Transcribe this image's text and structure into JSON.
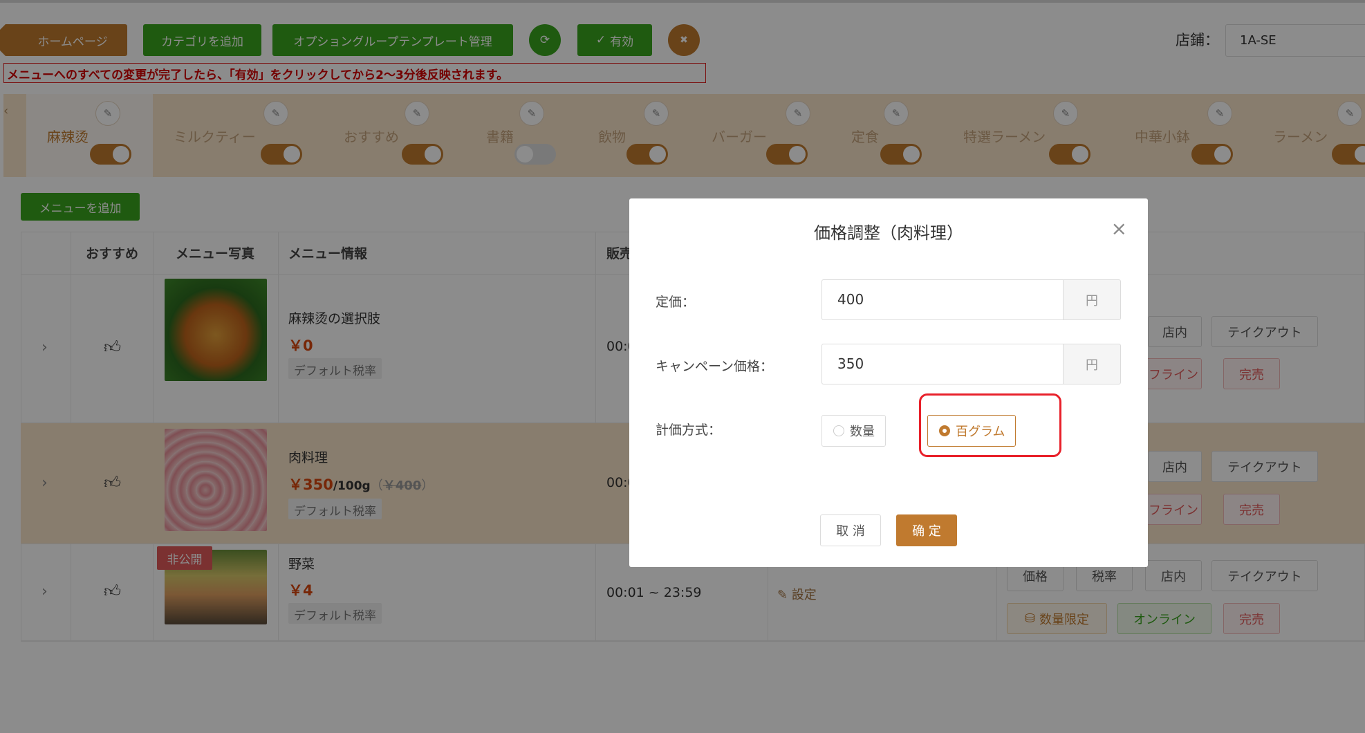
{
  "toolbar": {
    "home_label": "ホームページ",
    "add_category_label": "カテゴリを追加",
    "template_label": "オプショングループテンプレート管理",
    "valid_label": "有効",
    "store_label": "店鋪：",
    "store_value": "1A-SE"
  },
  "notice": "メニューへのすべての変更が完了したら、「有効」をクリックしてから2〜3分後反映されます。",
  "categories": [
    {
      "name": "麻辣烫",
      "enabled": true
    },
    {
      "name": "ミルクティー",
      "enabled": true
    },
    {
      "name": "おすすめ",
      "enabled": true
    },
    {
      "name": "書籍",
      "enabled": false
    },
    {
      "name": "飲物",
      "enabled": true
    },
    {
      "name": "バーガー",
      "enabled": true
    },
    {
      "name": "定食",
      "enabled": true
    },
    {
      "name": "特選ラーメン",
      "enabled": true
    },
    {
      "name": "中華小鉢",
      "enabled": true
    },
    {
      "name": "ラーメン",
      "enabled": true
    }
  ],
  "add_menu_label": "メニューを追加",
  "table": {
    "headers": [
      "おすすめ",
      "メニュー写真",
      "メニュー情報",
      "販売"
    ],
    "rows": [
      {
        "name": "麻辣烫の選択肢",
        "price": "￥0",
        "tax": "デフォルト税率",
        "time": "00:0",
        "tags": [
          "店内",
          "テイクアウト",
          "フライン",
          "完売"
        ]
      },
      {
        "name": "肉料理",
        "price": "￥350",
        "unit": "/100g",
        "orig_open": "（",
        "orig_price": "￥400",
        "orig_close": "）",
        "tax": "デフォルト税率",
        "time": "00:0",
        "tags": [
          "店内",
          "テイクアウト",
          "フライン",
          "完売"
        ]
      },
      {
        "name": "野菜",
        "price": "￥4",
        "tax": "デフォルト税率",
        "time": "00:01 ~ 23:59",
        "setting": "設定",
        "private": "非公開",
        "tags": [
          "価格",
          "税率",
          "店内",
          "テイクアウト",
          "数量限定",
          "オンライン",
          "完売"
        ]
      }
    ]
  },
  "modal": {
    "title": "価格調整（肉料理）",
    "list_price_label": "定価：",
    "list_price_value": "400",
    "campaign_label": "キャンペーン価格：",
    "campaign_value": "350",
    "currency": "円",
    "pricing_label": "計価方式：",
    "option_quantity": "数量",
    "option_100g": "百グラム",
    "selected": "百グラム",
    "cancel_label": "取 消",
    "ok_label": "确 定"
  },
  "colors": {
    "accent": "#c07a2f",
    "green": "#3aa51e",
    "highlight": "#e8202a"
  }
}
